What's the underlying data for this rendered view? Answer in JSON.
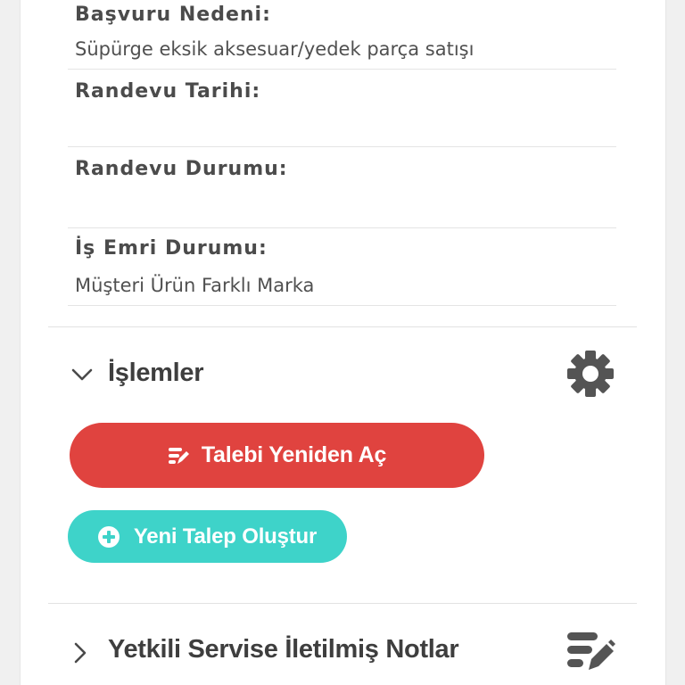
{
  "fields": [
    {
      "label": "Başvuru Nedeni:",
      "value": "Süpürge eksik aksesuar/yedek parça satışı"
    },
    {
      "label": "Randevu Tarihi:",
      "value": ""
    },
    {
      "label": "Randevu Durumu:",
      "value": ""
    },
    {
      "label": "İş Emri Durumu:",
      "value": "Müşteri Ürün Farklı Marka"
    }
  ],
  "actions_section": {
    "title": "İşlemler",
    "expanded": true,
    "reopen_button": {
      "label": "Talebi Yeniden Aç",
      "color": "#e0433f",
      "icon": "edit-list-icon"
    },
    "new_request_button": {
      "label": "Yeni Talep Oluştur",
      "color": "#3ed3c9",
      "icon": "plus-circle-icon"
    },
    "settings_icon": "gear-icon"
  },
  "notes_section": {
    "title": "Yetkili Servise İletilmiş Notlar",
    "expanded": false,
    "icon": "edit-list-icon"
  }
}
